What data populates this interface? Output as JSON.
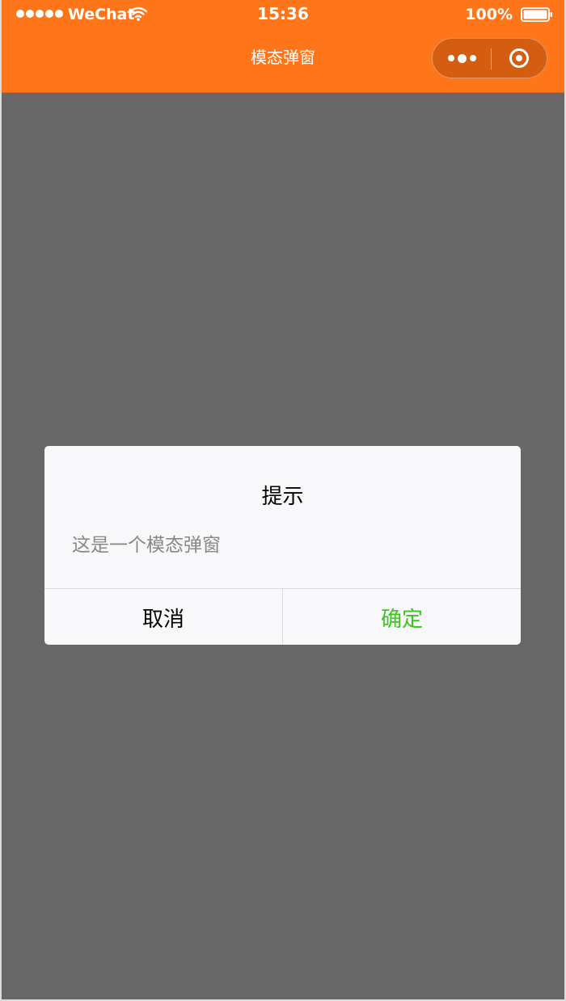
{
  "status_bar": {
    "carrier": "WeChat",
    "time": "15:36",
    "battery": "100%",
    "icons": [
      "signal-dots-icon",
      "wifi-icon",
      "battery-icon"
    ]
  },
  "nav": {
    "title": "模态弹窗",
    "icons": [
      "more-icon",
      "close-icon"
    ]
  },
  "modal": {
    "title": "提示",
    "content": "这是一个模态弹窗",
    "cancel_label": "取消",
    "confirm_label": "确定"
  },
  "colors": {
    "nav_background": "#ff7519",
    "overlay": "#676767",
    "modal_background": "#f8f8fa",
    "confirm_text": "#3cc51f",
    "content_text": "#888888"
  }
}
